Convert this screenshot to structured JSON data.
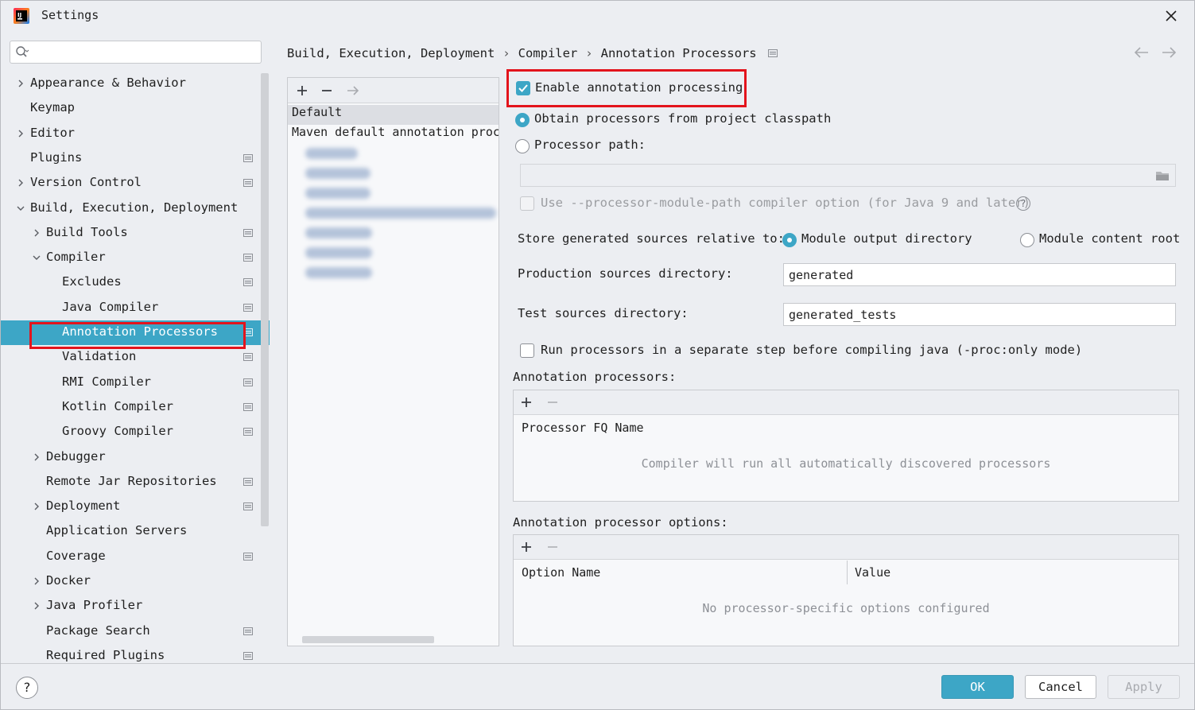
{
  "window": {
    "title": "Settings"
  },
  "colors": {
    "accent": "#3da6c6",
    "highlight_box": "#e3141c"
  },
  "sidebar": {
    "search_placeholder": "",
    "items": [
      {
        "label": "Appearance & Behavior",
        "level": 0,
        "expander": "collapsed",
        "project_icon": false
      },
      {
        "label": "Keymap",
        "level": 0,
        "expander": "none",
        "project_icon": false
      },
      {
        "label": "Editor",
        "level": 0,
        "expander": "collapsed",
        "project_icon": false
      },
      {
        "label": "Plugins",
        "level": 0,
        "expander": "none",
        "project_icon": true
      },
      {
        "label": "Version Control",
        "level": 0,
        "expander": "collapsed",
        "project_icon": true
      },
      {
        "label": "Build, Execution, Deployment",
        "level": 0,
        "expander": "expanded",
        "project_icon": false
      },
      {
        "label": "Build Tools",
        "level": 1,
        "expander": "collapsed",
        "project_icon": true
      },
      {
        "label": "Compiler",
        "level": 1,
        "expander": "expanded",
        "project_icon": true
      },
      {
        "label": "Excludes",
        "level": 2,
        "expander": "none",
        "project_icon": true
      },
      {
        "label": "Java Compiler",
        "level": 2,
        "expander": "none",
        "project_icon": true
      },
      {
        "label": "Annotation Processors",
        "level": 2,
        "expander": "none",
        "project_icon": true,
        "selected": true
      },
      {
        "label": "Validation",
        "level": 2,
        "expander": "none",
        "project_icon": true
      },
      {
        "label": "RMI Compiler",
        "level": 2,
        "expander": "none",
        "project_icon": true
      },
      {
        "label": "Kotlin Compiler",
        "level": 2,
        "expander": "none",
        "project_icon": true
      },
      {
        "label": "Groovy Compiler",
        "level": 2,
        "expander": "none",
        "project_icon": true
      },
      {
        "label": "Debugger",
        "level": 1,
        "expander": "collapsed",
        "project_icon": false
      },
      {
        "label": "Remote Jar Repositories",
        "level": 1,
        "expander": "none",
        "project_icon": true
      },
      {
        "label": "Deployment",
        "level": 1,
        "expander": "collapsed",
        "project_icon": true
      },
      {
        "label": "Application Servers",
        "level": 1,
        "expander": "none",
        "project_icon": false
      },
      {
        "label": "Coverage",
        "level": 1,
        "expander": "none",
        "project_icon": true
      },
      {
        "label": "Docker",
        "level": 1,
        "expander": "collapsed",
        "project_icon": false
      },
      {
        "label": "Java Profiler",
        "level": 1,
        "expander": "collapsed",
        "project_icon": false
      },
      {
        "label": "Package Search",
        "level": 1,
        "expander": "none",
        "project_icon": true
      },
      {
        "label": "Required Plugins",
        "level": 1,
        "expander": "none",
        "project_icon": true
      }
    ]
  },
  "breadcrumb": [
    "Build, Execution, Deployment",
    "Compiler",
    "Annotation Processors"
  ],
  "breadcrumb_separator": "›",
  "profiles": {
    "rows": [
      "Default",
      "Maven default annotation proc"
    ],
    "selected_index": 0,
    "blurred_module_count": 7
  },
  "settings": {
    "enable_processing": {
      "label": "Enable annotation processing",
      "checked": true
    },
    "obtain_from_classpath": {
      "label": "Obtain processors from project classpath",
      "selected": true
    },
    "processor_path": {
      "label": "Processor path:",
      "selected": false,
      "value": ""
    },
    "module_path_option": {
      "label": "Use --processor-module-path compiler option (for Java 9 and later)",
      "checked": false,
      "enabled": false
    },
    "store_relative_label": "Store generated sources relative to:",
    "store_module_output": {
      "label": "Module output directory",
      "selected": true
    },
    "store_content_root": {
      "label": "Module content root",
      "selected": false
    },
    "production_dir": {
      "label": "Production sources directory:",
      "value": "generated"
    },
    "test_dir": {
      "label": "Test sources directory:",
      "value": "generated_tests"
    },
    "separate_step": {
      "label": "Run processors in a separate step before compiling java (-proc:only mode)",
      "checked": false
    },
    "processors_section": {
      "title": "Annotation processors:",
      "column": "Processor FQ Name",
      "empty_text": "Compiler will run all automatically discovered processors"
    },
    "options_section": {
      "title": "Annotation processor options:",
      "columns": [
        "Option Name",
        "Value"
      ],
      "empty_text": "No processor-specific options configured"
    }
  },
  "footer": {
    "help": "?",
    "ok": "OK",
    "cancel": "Cancel",
    "apply": "Apply"
  }
}
